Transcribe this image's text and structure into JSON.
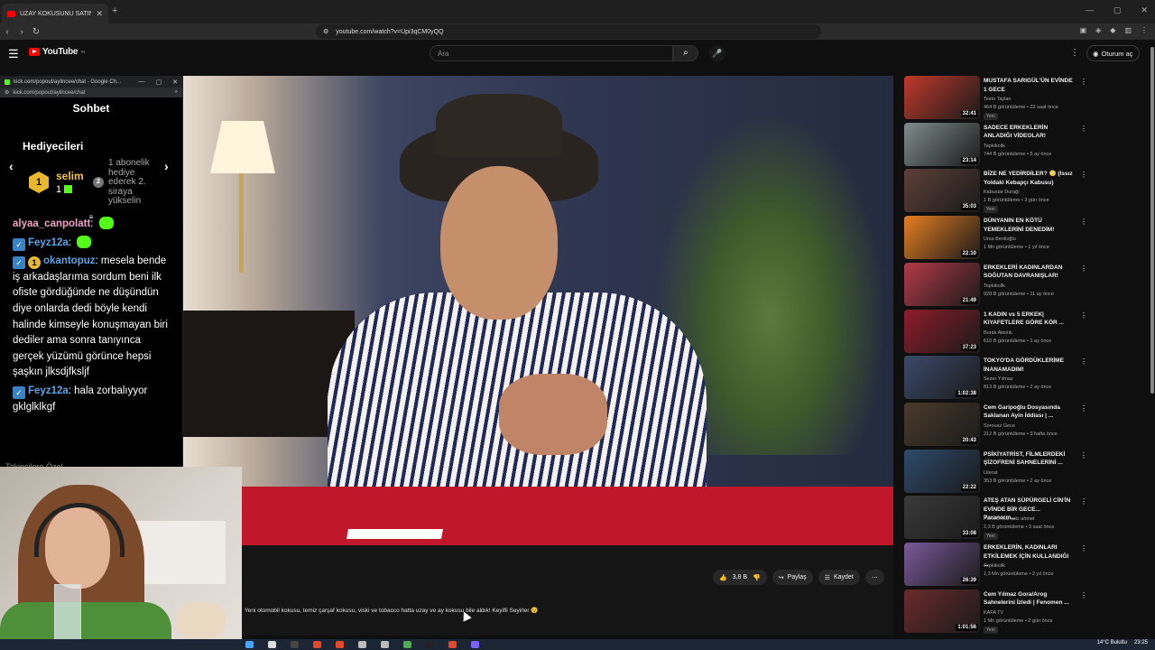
{
  "browser": {
    "tab_title": "UZAY KOKUSUNU SATIN ALDIK",
    "url": "youtube.com/watch?v=Upi3qCM0yQQ"
  },
  "youtube": {
    "logo_text": "YouTube",
    "logo_region": "TR",
    "search_placeholder": "Ara",
    "signin_label": "Oturum aç"
  },
  "video": {
    "likes": "3,8 B",
    "share_label": "Paylaş",
    "save_label": "Kaydet",
    "description": "Yeni otomobil kokusu, temiz çarşaf kokusu, viski ve tobacco hatta uzay ve ay kokusu bile aldık! Keyifli Seyirler 😉"
  },
  "chat_popup": {
    "window_title": "kick.com/popout/aylincee/chat - Google Ch...",
    "url": "kick.com/popout/aylincee/chat",
    "header": "Sohbet",
    "gifters_title": "Hediyecileri",
    "top_gifter": {
      "rank": "1",
      "name": "selim",
      "count": "1"
    },
    "next_rank": "2",
    "next_text": "1 abonelik hediye ederek 2. siraya yükselin",
    "followers_label": "Takipçilere Özel",
    "messages": [
      {
        "user": "alyaa_canpolatt",
        "text": ""
      },
      {
        "user": "Feyz12a",
        "text": ""
      },
      {
        "user": "okantopuz",
        "text": "mesela bende iş arkadaşlarıma sordum beni ilk ofiste gördüğünde ne düşündün diye onlarda dedi böyle kendi halinde kimseyle konuşmayan biri dediler ama sonra tanıyınca gerçek yüzümü görünce hepsi şaşkın jlksdjfksljf"
      },
      {
        "user": "Feyz12a",
        "text": "hala zorbalıyyor gklglklkgf"
      }
    ]
  },
  "recommendations": [
    {
      "title": "MUSTAFA SARIGÜL'ÜN EVİNDE 1 GECE",
      "channel": "Testo Taylan",
      "meta": "464 B görüntüleme • 22 saat önce",
      "badge": "Yeni",
      "duration": "32:41"
    },
    {
      "title": "SADECE ERKEKLERİN ANLADIĞI VİDEOLAR!",
      "channel": "Tepkikolik",
      "meta": "744 B görüntüleme • 5 ay önce",
      "badge": "",
      "duration": "23:14"
    },
    {
      "title": "BİZE NE YEDİRDİLER? 😳 (Issız Yoldaki Kebapçı Kabusu)",
      "channel": "Kabusiar Durağı",
      "meta": "1 B görüntüleme • 3 gün önce",
      "badge": "Yeni",
      "duration": "35:03"
    },
    {
      "title": "DÜNYANIN EN KÖTÜ YEMEKLERİNİ DENEDİM!",
      "channel": "Ursa Benlioğlu",
      "meta": "1 Mn görüntüleme • 1 yıl önce",
      "badge": "",
      "duration": "22:10"
    },
    {
      "title": "ERKEKLERİ KADINLARDAN SOĞUTAN DAVRANIŞLAR!",
      "channel": "Tepkikolik",
      "meta": "928 B görüntüleme • 11 ay önce",
      "badge": "",
      "duration": "21:49"
    },
    {
      "title": "1 KADIN vs 5 ERKEK| KIYAFETLERE GÖRE KÖR ...",
      "channel": "Burak Akinlık",
      "meta": "610 B görüntüleme • 1 ay önce",
      "badge": "",
      "duration": "37:23"
    },
    {
      "title": "TOKYO'DA GÖRDÜKLERİME İNANAMADIM!",
      "channel": "Sezer Yılmaz",
      "meta": "813 B görüntüleme • 2 ay önce",
      "badge": "",
      "duration": "1:02:38"
    },
    {
      "title": "Cem Garipoğlu Dosyasında Saklanan Ayin İddiası | ...",
      "channel": "Sorousz Gece",
      "meta": "212 B görüntüleme • 3 hafta önce",
      "badge": "",
      "duration": "20:43"
    },
    {
      "title": "PSİKİYATRİST, FİLMLERDEKİ ŞİZOFRENİ SAHNELERİNİ ...",
      "channel": "Literat",
      "meta": "353 B görüntüleme • 2 ay önce",
      "badge": "",
      "duration": "22:22"
    },
    {
      "title": "ATEŞ ATAN SÜPÜRGELİ CİN'İN EVİNDE BİR GECE... Paranorm...",
      "channel": "Paranormal aziz ahmet",
      "meta": "2,3 B görüntüleme • 3 saat önce",
      "badge": "Yeni",
      "duration": "33:08"
    },
    {
      "title": "ERKEKLERİN, KADINLARI ETKİLEMEK İÇİN KULLANDIĞI ...",
      "channel": "Tepkikolik",
      "meta": "1,3 Mn görüntüleme • 2 yıl önce",
      "badge": "",
      "duration": "26:39"
    },
    {
      "title": "Cem Yılmaz Gora/Arog Sahnelerini İzledi | Fenomen ...",
      "channel": "KAFA TV",
      "meta": "1 Mn görüntüleme • 2 gün önce",
      "badge": "Yeni",
      "duration": "1:01:56"
    }
  ],
  "taskbar": {
    "weather": "14°C Bulutlu",
    "time": "23:25"
  },
  "colors": {
    "brand_red": "#ff0000",
    "kick_green": "#53fc18",
    "gifter_gold": "#f5c541",
    "username_blue": "#5ba4e6"
  }
}
